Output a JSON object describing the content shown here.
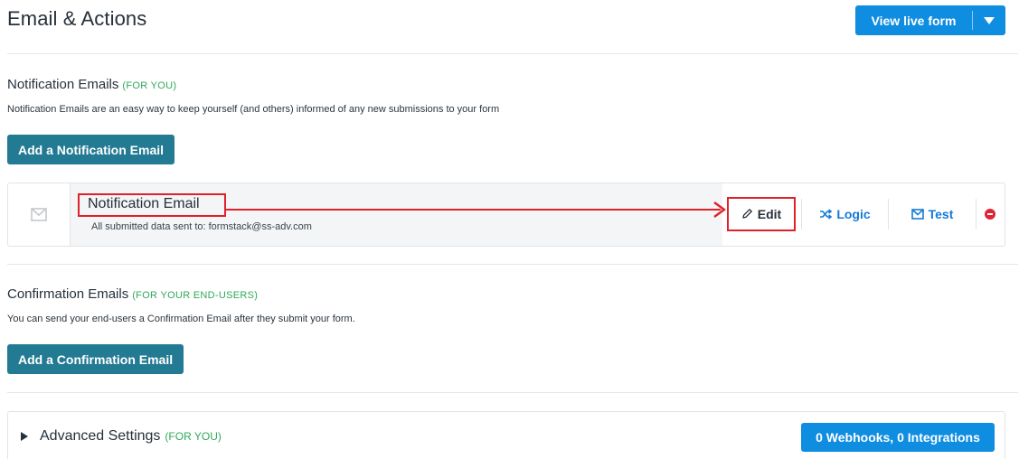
{
  "header": {
    "title": "Email & Actions",
    "live_button_label": "View live form"
  },
  "notification": {
    "title": "Notification Emails",
    "tag": "(FOR YOU)",
    "description": "Notification Emails are an easy way to keep yourself (and others) informed of any new submissions to your form",
    "add_button": "Add a Notification Email",
    "items": [
      {
        "name": "Notification Email",
        "subtitle": "All submitted data sent to: formstack@ss-adv.com",
        "actions": {
          "edit": "Edit",
          "logic": "Logic",
          "test": "Test"
        }
      }
    ]
  },
  "confirmation": {
    "title": "Confirmation Emails",
    "tag": "(FOR YOUR END-USERS)",
    "description": "You can send your end-users a Confirmation Email after they submit your form.",
    "add_button": "Add a Confirmation Email"
  },
  "advanced": {
    "title": "Advanced Settings",
    "tag": "(FOR YOU)",
    "webhooks_button": "0 Webhooks, 0 Integrations"
  },
  "colors": {
    "primary_blue": "#0f8de0",
    "teal_button": "#237a93",
    "green_tag": "#2fa85a",
    "highlight_red": "#e0202a",
    "danger_red": "#e02434"
  },
  "icons": {
    "email_item": "envelope-icon",
    "edit": "pencil-icon",
    "logic": "shuffle-icon",
    "test": "envelope-icon",
    "remove": "minus-circle-icon",
    "dropdown": "caret-down-icon",
    "advanced_toggle": "triangle-right-icon"
  }
}
